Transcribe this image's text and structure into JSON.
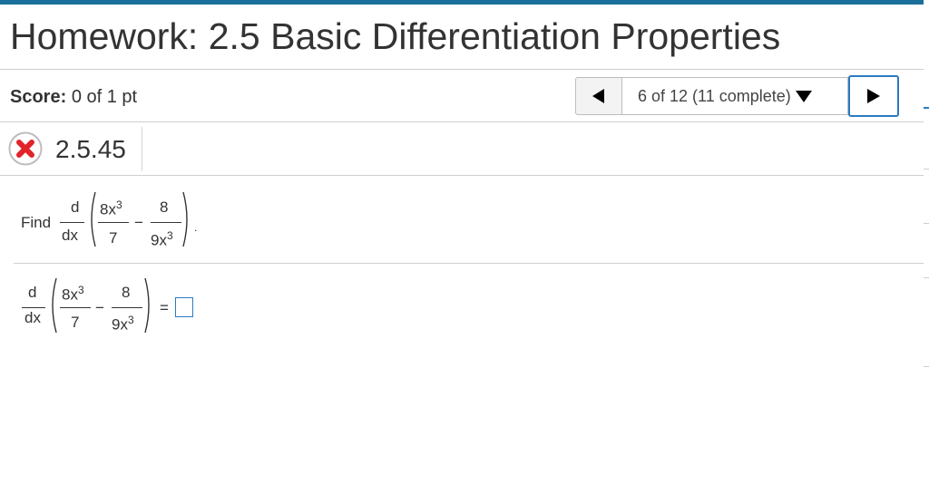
{
  "header": {
    "title": "Homework: 2.5 Basic Differentiation Properties"
  },
  "score": {
    "label": "Score:",
    "value": "0 of 1 pt"
  },
  "navigation": {
    "position_text": "6 of 12 (11 complete)",
    "prev_icon": "triangle-left-icon",
    "next_icon": "triangle-right-icon",
    "dropdown_icon": "triangle-down-icon"
  },
  "question": {
    "number": "2.5.45",
    "status_icon": "incorrect-x-icon",
    "status_color": "#e0242a",
    "prompt_word": "Find",
    "derivative_numerator": "d",
    "derivative_denominator": "dx",
    "term1_numerator": "8x",
    "term1_exponent": "3",
    "term1_denominator": "7",
    "operator": "−",
    "term2_numerator": "8",
    "term2_denominator": "9x",
    "term2_exponent": "3",
    "period": ".",
    "equals": "="
  },
  "answer": {
    "value": ""
  },
  "colors": {
    "accent_bar": "#1a6f9c",
    "focus_blue": "#2b7bc0"
  }
}
